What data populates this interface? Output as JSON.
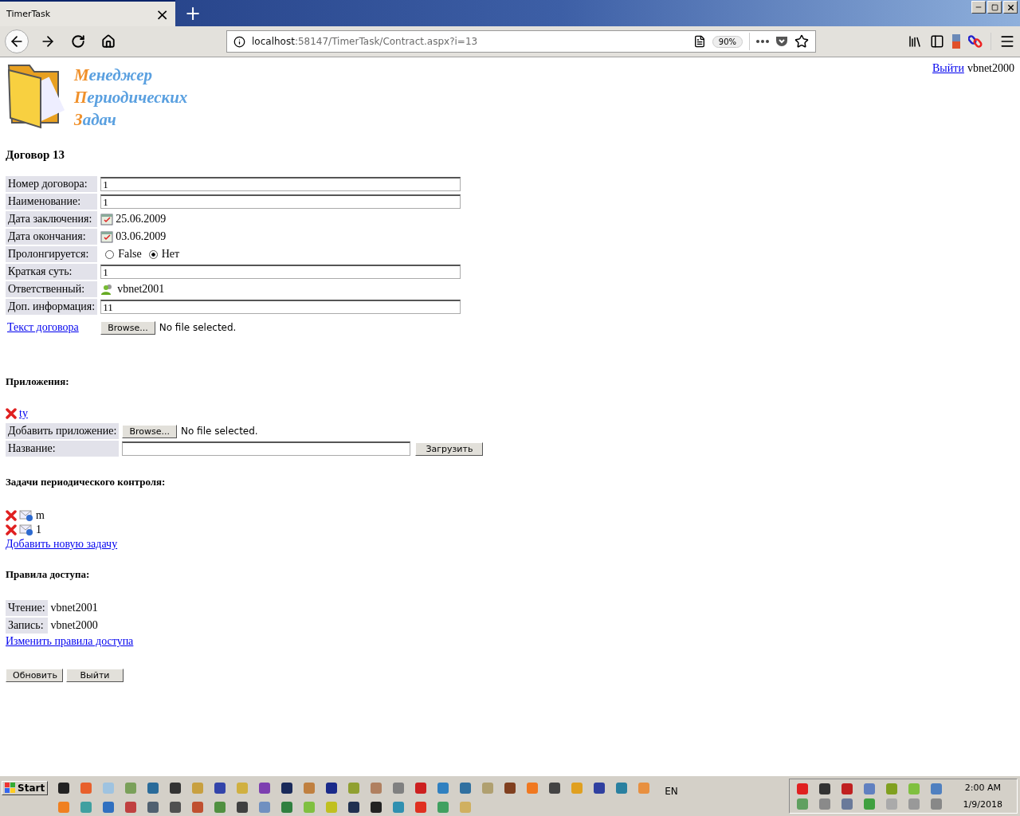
{
  "browser": {
    "tab_title": "TimerTask",
    "tab_close": "×",
    "new_tab": "+",
    "url_host": "localhost",
    "url_path": ":58147/TimerTask/Contract.aspx?i=13",
    "zoom": "90%"
  },
  "header": {
    "logo_lines": [
      "Менеджер",
      "Периодических",
      "Задач"
    ],
    "logout_link": "Выйти",
    "user": "vbnet2000"
  },
  "title": "Договор 13",
  "fields": [
    {
      "kind": "text",
      "label": "Номер договора:",
      "value": "1"
    },
    {
      "kind": "text",
      "label": "Наименование:",
      "value": "1"
    },
    {
      "kind": "date",
      "label": "Дата заключения:",
      "value": "25.06.2009"
    },
    {
      "kind": "date",
      "label": "Дата окончания:",
      "value": "03.06.2009"
    },
    {
      "kind": "radio",
      "label": "Пролонгируется:",
      "options": [
        {
          "label": "False",
          "selected": false
        },
        {
          "label": "Нет",
          "selected": true
        }
      ]
    },
    {
      "kind": "text",
      "label": "Краткая суть:",
      "value": "1"
    },
    {
      "kind": "user",
      "label": "Ответственный:",
      "value": "vbnet2001"
    },
    {
      "kind": "text",
      "label": "Доп. информация:",
      "value": "11"
    },
    {
      "kind": "file",
      "link": "Текст договора",
      "button": "Browse...",
      "status": "No file selected."
    }
  ],
  "attachments": {
    "heading": "Приложения:",
    "items": [
      "ty"
    ],
    "add_label": "Добавить приложение:",
    "browse": "Browse...",
    "status": "No file selected.",
    "name_label": "Название:",
    "upload": "Загрузить"
  },
  "tasks": {
    "heading": "Задачи периодического контроля:",
    "items": [
      "m",
      "1"
    ],
    "add_link": "Добавить новую задачу"
  },
  "access": {
    "heading": "Правила доступа:",
    "rules": [
      {
        "label": "Чтение:",
        "value": "vbnet2001"
      },
      {
        "label": "Запись:",
        "value": "vbnet2000"
      }
    ],
    "change_link": "Изменить правила доступа"
  },
  "buttons": [
    "Обновить",
    "Выйти"
  ],
  "taskbar": {
    "start": "Start",
    "language": "EN",
    "time": "2:00 AM",
    "date": "1/9/2018"
  }
}
